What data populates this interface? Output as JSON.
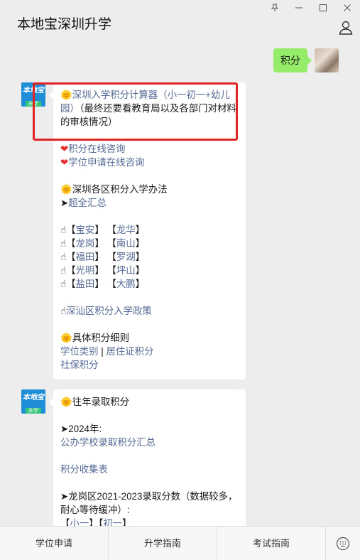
{
  "window": {
    "title": "本地宝深圳升学",
    "controls": {
      "pin": "⊥",
      "minimize": "—",
      "maximize": "□",
      "close": "✕"
    }
  },
  "me": {
    "message": "积分"
  },
  "bot": {
    "avatar_top": "本地宝",
    "avatar_bottom": "升学"
  },
  "msg1": {
    "calc_link": "深圳入学积分计算器（小一初一+幼儿园）",
    "calc_note": "（最终还要看教育局以及各部门对材料的审核情况）",
    "consult1": "积分在线咨询",
    "consult2": "学位申请在线咨询",
    "methods_title": "深圳各区积分入学办法",
    "arrow": "➤",
    "all_link": "超全汇总",
    "hand": "☝",
    "bracket_l": "【",
    "bracket_r": "】",
    "districts": [
      [
        "宝安",
        "龙华"
      ],
      [
        "龙岗",
        "南山"
      ],
      [
        "福田",
        "罗湖"
      ],
      [
        "光明",
        "坪山"
      ],
      [
        "盐田",
        "大鹏"
      ]
    ],
    "shenshan": "深汕区积分入学政策",
    "detail_title": "具体积分细则",
    "detail_a": "学位类别",
    "sep": " | ",
    "detail_b": "居住证积分",
    "detail_c": "社保积分"
  },
  "msg2": {
    "past_title": "往年录取积分",
    "y2024": "➤2024年:",
    "public_link": "公办学校录取积分汇总",
    "collect_link": "积分收集表",
    "longgang": "➤龙岗区2021-2023录取分数（数据较多，耐心等待缓冲）:",
    "partial_a": "小一",
    "partial_b": "初一"
  },
  "tabs": [
    "学位申请",
    "升学指南",
    "考试指南"
  ]
}
